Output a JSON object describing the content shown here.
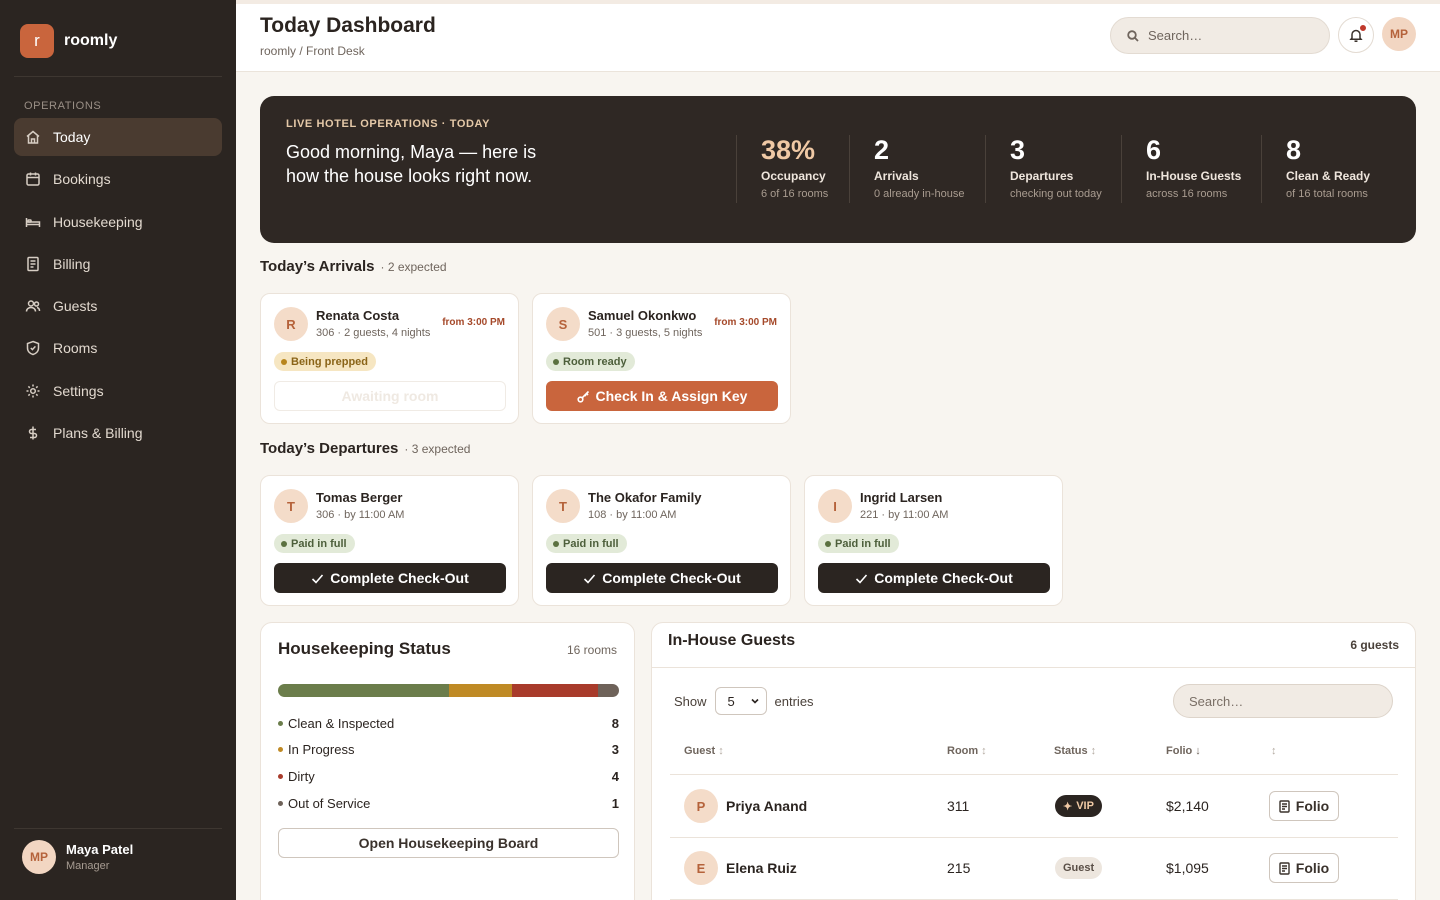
{
  "brand": {
    "logo_letter": "r",
    "name": "roomly"
  },
  "sidebar": {
    "section_label": "OPERATIONS",
    "items": [
      {
        "label": "Today",
        "icon": "home-icon",
        "active": true
      },
      {
        "label": "Bookings",
        "icon": "calendar-icon"
      },
      {
        "label": "Housekeeping",
        "icon": "bed-icon"
      },
      {
        "label": "Billing",
        "icon": "receipt-icon"
      },
      {
        "label": "Guests",
        "icon": "users-icon"
      },
      {
        "label": "Rooms",
        "icon": "shield-icon"
      },
      {
        "label": "Settings",
        "icon": "gear-icon"
      },
      {
        "label": "Plans & Billing",
        "icon": "dollar-icon"
      }
    ],
    "user": {
      "initials": "MP",
      "name": "Maya Patel",
      "role": "Manager"
    }
  },
  "header": {
    "title": "Today Dashboard",
    "breadcrumb": "roomly / Front Desk",
    "search_placeholder": "Search…",
    "avatar_initials": "MP"
  },
  "hero": {
    "eyebrow": "LIVE HOTEL OPERATIONS · TODAY",
    "greeting": "Good morning, Maya — here is how the house looks right now.",
    "stats": [
      {
        "value": "38%",
        "label": "Occupancy",
        "sub": "6 of 16 rooms"
      },
      {
        "value": "2",
        "label": "Arrivals",
        "sub": "0 already in-house"
      },
      {
        "value": "3",
        "label": "Departures",
        "sub": "checking out today"
      },
      {
        "value": "6",
        "label": "In-House Guests",
        "sub": "across 16 rooms"
      },
      {
        "value": "8",
        "label": "Clean & Ready",
        "sub": "of 16 total rooms"
      }
    ]
  },
  "arrivals": {
    "title": "Today’s Arrivals",
    "count": "· 2 expected",
    "cards": [
      {
        "initial": "R",
        "name": "Renata Costa",
        "details": "306 · 2 guests, 4 nights",
        "time": "from 3:00 PM",
        "status": "Being prepped",
        "button": "Awaiting room"
      },
      {
        "initial": "S",
        "name": "Samuel Okonkwo",
        "details": "501 · 3 guests, 5 nights",
        "time": "from 3:00 PM",
        "status": "Room ready",
        "button": "Check In & Assign Key"
      }
    ]
  },
  "departures": {
    "title": "Today’s Departures",
    "count": "· 3 expected",
    "cards": [
      {
        "initial": "T",
        "name": "Tomas Berger",
        "details": "306 · by 11:00 AM",
        "status": "Paid in full",
        "button": "Complete Check-Out"
      },
      {
        "initial": "T",
        "name": "The Okafor Family",
        "details": "108 · by 11:00 AM",
        "status": "Paid in full",
        "button": "Complete Check-Out"
      },
      {
        "initial": "I",
        "name": "Ingrid Larsen",
        "details": "221 · by 11:00 AM",
        "status": "Paid in full",
        "button": "Complete Check-Out"
      }
    ]
  },
  "housekeeping": {
    "title": "Housekeeping Status",
    "count": "16 rooms",
    "rows": [
      {
        "label": "Clean & Inspected",
        "value": "8",
        "color": "#6b7d4b"
      },
      {
        "label": "In Progress",
        "value": "3",
        "color": "#bf8a25"
      },
      {
        "label": "Dirty",
        "value": "4",
        "color": "#a83b2b"
      },
      {
        "label": "Out of Service",
        "value": "1",
        "color": "#6e6259"
      }
    ],
    "button": "Open Housekeeping Board"
  },
  "inhouse": {
    "title": "In-House Guests",
    "count": "6 guests",
    "show_label": "Show",
    "entries_value": "5",
    "entries_label": "entries",
    "search_placeholder": "Search…",
    "columns": {
      "guest": "Guest",
      "room": "Room",
      "status": "Status",
      "folio": "Folio"
    },
    "rows": [
      {
        "initial": "P",
        "name": "Priya Anand",
        "room": "311",
        "status": "VIP",
        "folio": "$2,140",
        "action": "Folio"
      },
      {
        "initial": "E",
        "name": "Elena Ruiz",
        "room": "215",
        "status": "Guest",
        "folio": "$1,095",
        "action": "Folio"
      }
    ]
  }
}
